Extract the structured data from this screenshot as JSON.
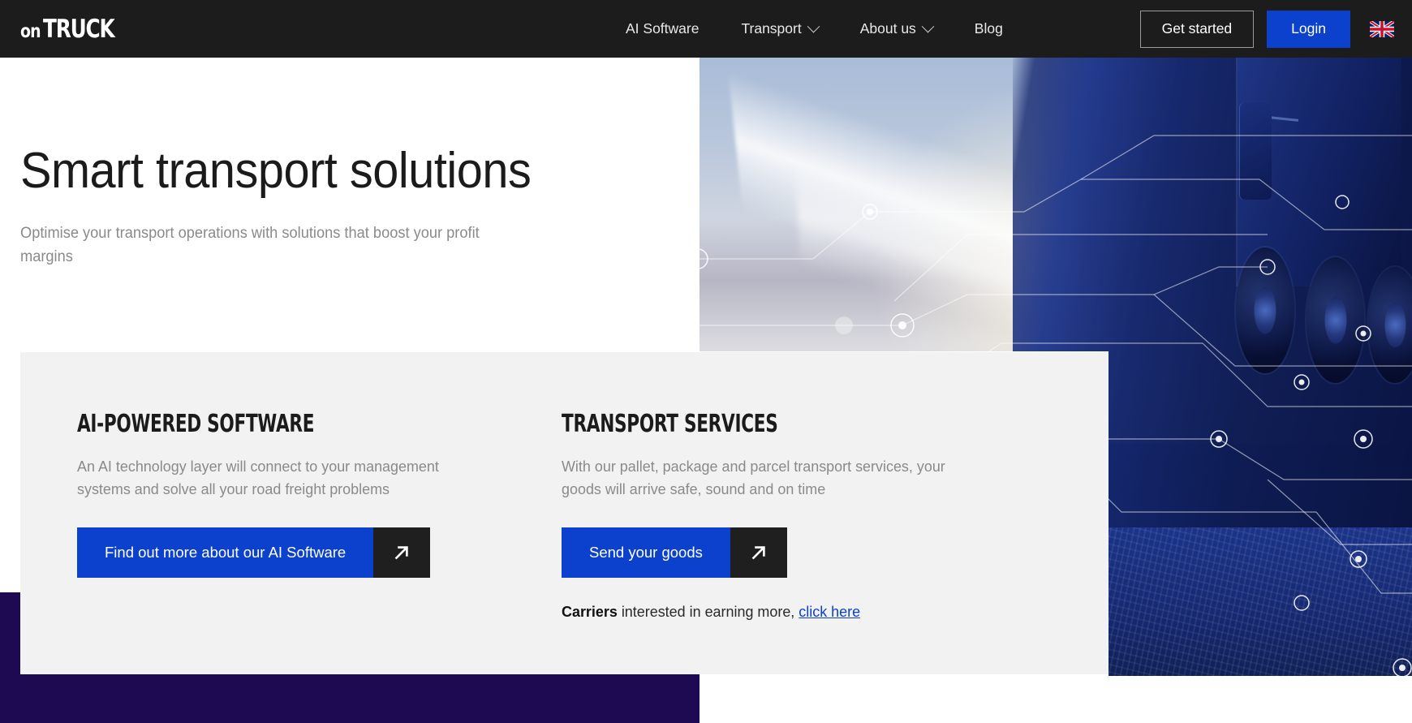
{
  "brand": {
    "logo_part1": "on",
    "logo_part2": "TRUCK",
    "accent_blue": "#0b41cd",
    "dark": "#1c1c1c",
    "purple": "#1e0a52",
    "card_bg": "#f2f2f2"
  },
  "nav": {
    "items": [
      {
        "label": "AI Software",
        "has_dropdown": false,
        "icon": ""
      },
      {
        "label": "Transport",
        "has_dropdown": true,
        "icon": "chevron-down-icon"
      },
      {
        "label": "About us",
        "has_dropdown": true,
        "icon": "chevron-down-icon"
      },
      {
        "label": "Blog",
        "has_dropdown": false,
        "icon": ""
      }
    ],
    "get_started_label": "Get started",
    "login_label": "Login",
    "language_flag": "uk-flag-icon"
  },
  "hero": {
    "title": "Smart transport solutions",
    "subtitle": "Optimise your transport operations with solutions that boost your profit margins",
    "image_alt": "blue-truck-network-overlay-image"
  },
  "features": [
    {
      "heading": "AI-POWERED SOFTWARE",
      "body": "An AI technology layer will connect to your management systems and solve all your road freight problems",
      "cta_label": "Find out more about our AI Software",
      "cta_icon": "arrow-up-right-icon"
    },
    {
      "heading": "TRANSPORT SERVICES",
      "body": "With our pallet, package and parcel transport services, your goods will arrive safe, sound and on time",
      "cta_label": "Send your goods",
      "cta_icon": "arrow-up-right-icon",
      "note_bold": "Carriers",
      "note_text": " interested in earning more, ",
      "note_link": "click here"
    }
  ]
}
